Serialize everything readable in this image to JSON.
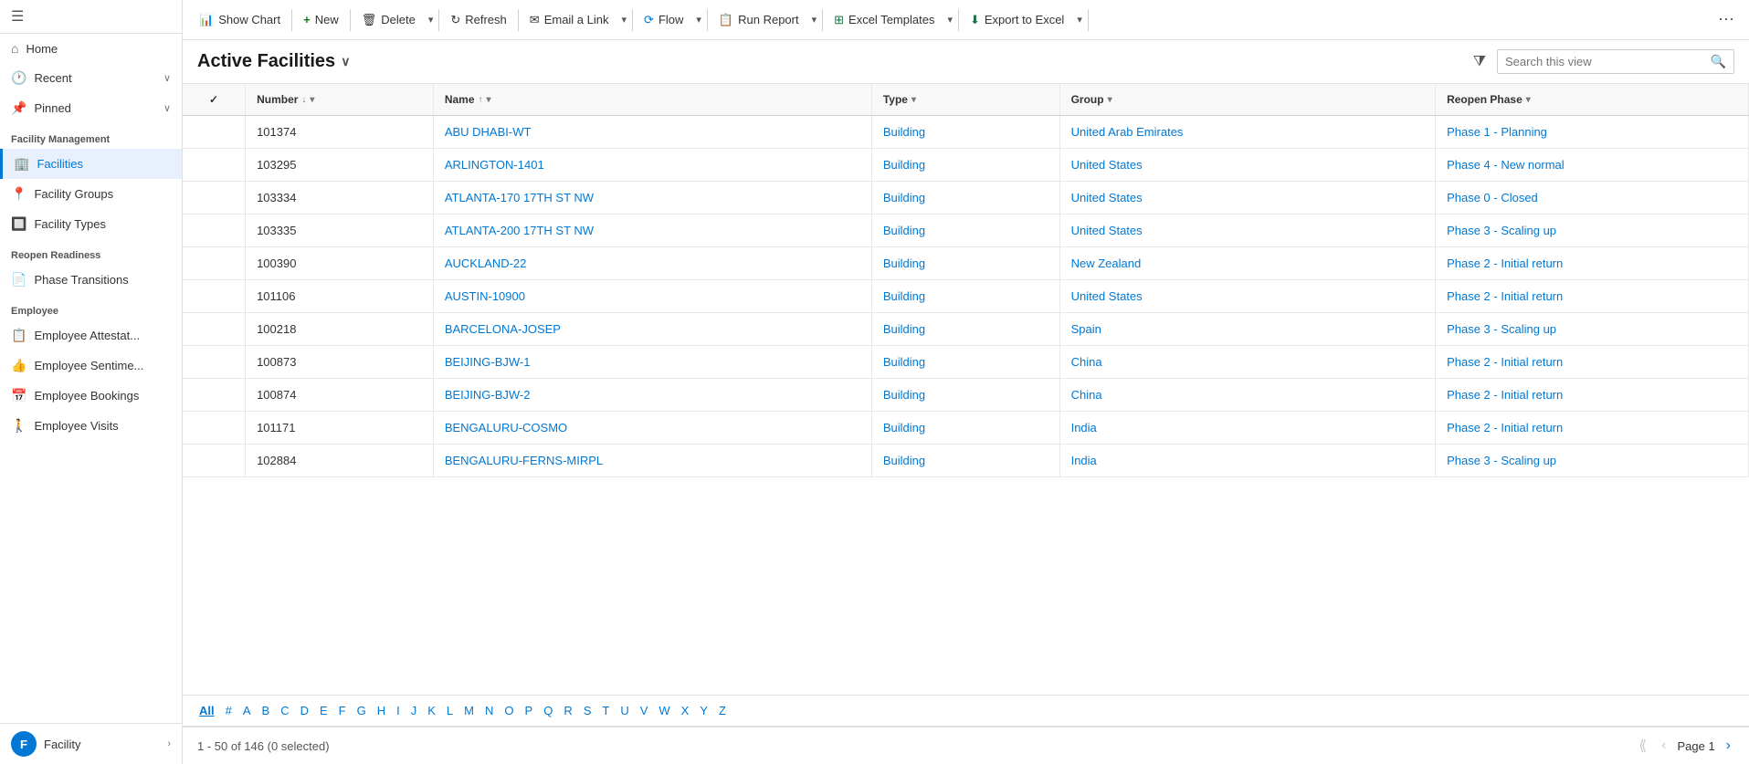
{
  "sidebar": {
    "hamburger": "☰",
    "nav": [
      {
        "id": "home",
        "icon": "⌂",
        "label": "Home",
        "hasChevron": false
      },
      {
        "id": "recent",
        "icon": "🕐",
        "label": "Recent",
        "hasChevron": true
      },
      {
        "id": "pinned",
        "icon": "📌",
        "label": "Pinned",
        "hasChevron": true
      }
    ],
    "sections": [
      {
        "label": "Facility Management",
        "items": [
          {
            "id": "facilities",
            "icon": "🏢",
            "label": "Facilities",
            "active": true
          },
          {
            "id": "facility-groups",
            "icon": "📍",
            "label": "Facility Groups",
            "active": false
          },
          {
            "id": "facility-types",
            "icon": "🔲",
            "label": "Facility Types",
            "active": false
          }
        ]
      },
      {
        "label": "Reopen Readiness",
        "items": [
          {
            "id": "phase-transitions",
            "icon": "📄",
            "label": "Phase Transitions",
            "active": false
          }
        ]
      },
      {
        "label": "Employee",
        "items": [
          {
            "id": "employee-attestat",
            "icon": "📋",
            "label": "Employee Attestat...",
            "active": false
          },
          {
            "id": "employee-sentime",
            "icon": "👍",
            "label": "Employee Sentime...",
            "active": false
          },
          {
            "id": "employee-bookings",
            "icon": "📅",
            "label": "Employee Bookings",
            "active": false
          },
          {
            "id": "employee-visits",
            "icon": "🚶",
            "label": "Employee Visits",
            "active": false
          }
        ]
      }
    ],
    "footer": {
      "avatar_letter": "F",
      "label": "Facility"
    }
  },
  "toolbar": {
    "show_chart_label": "Show Chart",
    "new_label": "New",
    "delete_label": "Delete",
    "refresh_label": "Refresh",
    "email_link_label": "Email a Link",
    "flow_label": "Flow",
    "run_report_label": "Run Report",
    "excel_templates_label": "Excel Templates",
    "export_to_excel_label": "Export to Excel"
  },
  "view_header": {
    "title": "Active Facilities",
    "search_placeholder": "Search this view"
  },
  "table": {
    "columns": [
      {
        "id": "number",
        "label": "Number",
        "sortable": true,
        "has_chevron": true
      },
      {
        "id": "name",
        "label": "Name",
        "sortable": true,
        "sort_dir": "asc",
        "has_chevron": true
      },
      {
        "id": "type",
        "label": "Type",
        "sortable": false,
        "has_chevron": true
      },
      {
        "id": "group",
        "label": "Group",
        "sortable": false,
        "has_chevron": true
      },
      {
        "id": "reopen_phase",
        "label": "Reopen Phase",
        "sortable": false,
        "has_chevron": true
      }
    ],
    "rows": [
      {
        "number": "101374",
        "name": "ABU DHABI-WT",
        "type": "Building",
        "group": "United Arab Emirates",
        "phase": "Phase 1 - Planning"
      },
      {
        "number": "103295",
        "name": "ARLINGTON-1401",
        "type": "Building",
        "group": "United States",
        "phase": "Phase 4 - New normal"
      },
      {
        "number": "103334",
        "name": "ATLANTA-170 17TH ST NW",
        "type": "Building",
        "group": "United States",
        "phase": "Phase 0 - Closed"
      },
      {
        "number": "103335",
        "name": "ATLANTA-200 17TH ST NW",
        "type": "Building",
        "group": "United States",
        "phase": "Phase 3 - Scaling up"
      },
      {
        "number": "100390",
        "name": "AUCKLAND-22",
        "type": "Building",
        "group": "New Zealand",
        "phase": "Phase 2 - Initial return"
      },
      {
        "number": "101106",
        "name": "AUSTIN-10900",
        "type": "Building",
        "group": "United States",
        "phase": "Phase 2 - Initial return"
      },
      {
        "number": "100218",
        "name": "BARCELONA-JOSEP",
        "type": "Building",
        "group": "Spain",
        "phase": "Phase 3 - Scaling up"
      },
      {
        "number": "100873",
        "name": "BEIJING-BJW-1",
        "type": "Building",
        "group": "China",
        "phase": "Phase 2 - Initial return"
      },
      {
        "number": "100874",
        "name": "BEIJING-BJW-2",
        "type": "Building",
        "group": "China",
        "phase": "Phase 2 - Initial return"
      },
      {
        "number": "101171",
        "name": "BENGALURU-COSMO",
        "type": "Building",
        "group": "India",
        "phase": "Phase 2 - Initial return"
      },
      {
        "number": "102884",
        "name": "BENGALURU-FERNS-MIRPL",
        "type": "Building",
        "group": "India",
        "phase": "Phase 3 - Scaling up"
      }
    ]
  },
  "alpha_nav": {
    "items": [
      "All",
      "#",
      "A",
      "B",
      "C",
      "D",
      "E",
      "F",
      "G",
      "H",
      "I",
      "J",
      "K",
      "L",
      "M",
      "N",
      "O",
      "P",
      "Q",
      "R",
      "S",
      "T",
      "U",
      "V",
      "W",
      "X",
      "Y",
      "Z"
    ],
    "active": "All"
  },
  "footer": {
    "count_label": "1 - 50 of 146 (0 selected)",
    "page_label": "Page 1"
  }
}
